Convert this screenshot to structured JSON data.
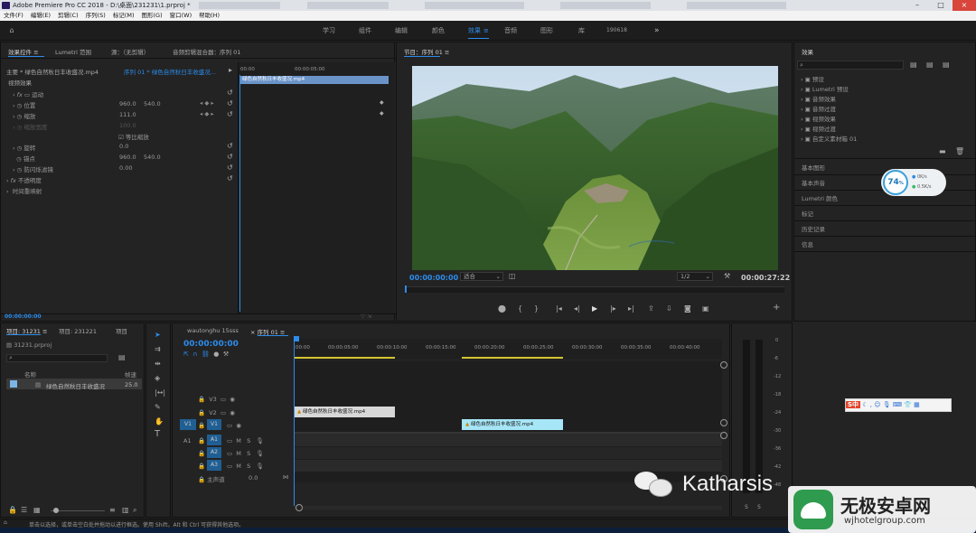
{
  "titlebar": {
    "title": "Adobe Premiere Pro CC 2018 - D:\\桌面\\231231\\1.prproj *"
  },
  "menu": [
    "文件(F)",
    "编辑(E)",
    "剪辑(C)",
    "序列(S)",
    "标记(M)",
    "图形(G)",
    "窗口(W)",
    "帮助(H)"
  ],
  "workspaces": [
    "学习",
    "组件",
    "编辑",
    "颜色",
    "效果",
    "音频",
    "图形",
    "库",
    "190618"
  ],
  "effect_controls": {
    "tabs": [
      "效果控件",
      "Lumetri 范围",
      "源：（无剪辑）",
      "音频剪辑混合器：序列 01"
    ],
    "clip_path": "主要 * 绿色自然秋日丰收盛况.mp4",
    "sequence_path": "序列 01 * 绿色自然秋日丰收盛况...",
    "section": "视频效果",
    "motion": "运动",
    "position": {
      "label": "位置",
      "x": "960.0",
      "y": "540.0"
    },
    "scale": {
      "label": "缩放",
      "value": "111.0"
    },
    "scale_width": {
      "label": "缩放宽度",
      "value": "100.0"
    },
    "uniform_scale": "等比缩放",
    "rotation": {
      "label": "旋转",
      "value": "0.0"
    },
    "anchor": {
      "label": "锚点",
      "x": "960.0",
      "y": "540.0"
    },
    "antiflicker": {
      "label": "防闪烁滤镜",
      "value": "0.00"
    },
    "opacity": "不透明度",
    "time_remap": "时间重映射",
    "ruler_start": "00:00",
    "ruler_mid": "00:00:05:00",
    "clip_label": "绿色自然秋日丰收盛况.mp4",
    "timecode": "00:00:00:00"
  },
  "program": {
    "title": "节目：序列 01",
    "timecode": "00:00:00:00",
    "fit": "适合",
    "quality": "1/2",
    "duration": "00:00:27:22"
  },
  "effects": {
    "title": "效果",
    "items": [
      "预设",
      "Lumetri 预设",
      "音频效果",
      "音频过渡",
      "视频效果",
      "视频过渡",
      "自定义素材箱 01"
    ],
    "sections": [
      "基本图形",
      "基本声音",
      "Lumetri 颜色",
      "标记",
      "历史记录",
      "信息"
    ]
  },
  "gauge": {
    "percent": "74",
    "unit": "%",
    "up": "0K/s",
    "down": "0.5K/s"
  },
  "project": {
    "tabs": [
      "项目: 31231",
      "项目: 231221",
      "项目"
    ],
    "file": "31231.prproj",
    "col_name": "名称",
    "col_rate": "帧速",
    "item": "绿色自然秋日丰收盛况",
    "item_rate": "25.0"
  },
  "timeline": {
    "tabs": [
      "wautonghu 15sss",
      "序列 01"
    ],
    "timecode": "00:00:00:00",
    "ruler": [
      "00:00",
      "00:00:05:00",
      "00:00:10:00",
      "00:00:15:00",
      "00:00:20:00",
      "00:00:25:00",
      "00:00:30:00",
      "00:00:35:00",
      "00:00:40:00"
    ],
    "video_tracks": [
      "V3",
      "V2",
      "V1"
    ],
    "audio_tracks": [
      "A1",
      "A2",
      "A3"
    ],
    "master": "主声道",
    "master_value": "0.0",
    "clip1": "绿色自然秋日丰收盛况.mp4",
    "clip2": "绿色自然秋日丰收盛况.mp4"
  },
  "meter_ticks": [
    "0",
    "-6",
    "-12",
    "-18",
    "-24",
    "-30",
    "-36",
    "-42",
    "-48"
  ],
  "meter_footer": [
    "S",
    "S"
  ],
  "ime": {
    "label": "S中"
  },
  "status": "单击以选择，或单击空白处并拖动以进行框选。使用 Shift，Alt 和 Ctrl 可获得其他选项。",
  "watermark": {
    "text": "Katharsis"
  },
  "logo": {
    "name": "无极安卓网",
    "url": "wjhotelgroup.com"
  },
  "colors": {
    "accent": "#2d8ceb",
    "clip_gray": "#d7d7d7",
    "clip_blue": "#a7e6f7",
    "bg": "#232323"
  }
}
